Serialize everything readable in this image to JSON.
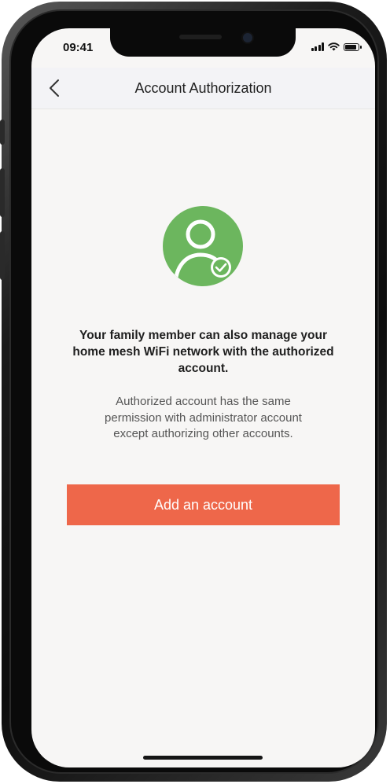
{
  "status_bar": {
    "time": "09:41",
    "icons": [
      "signal-icon",
      "wifi-icon",
      "battery-icon"
    ]
  },
  "nav": {
    "back_icon": "chevron-left-icon",
    "title": "Account Authorization"
  },
  "avatar": {
    "icon": "user-check-icon",
    "color": "#6cb65e"
  },
  "content": {
    "primary_lines": [
      "Your family member can also manage your",
      "home mesh WiFi network with the authorized",
      "account."
    ],
    "secondary_lines": [
      "Authorized account has the same",
      "permission with administrator account",
      "except authorizing other accounts."
    ]
  },
  "actions": {
    "add_account_label": "Add an account",
    "button_color": "#ee674a"
  }
}
